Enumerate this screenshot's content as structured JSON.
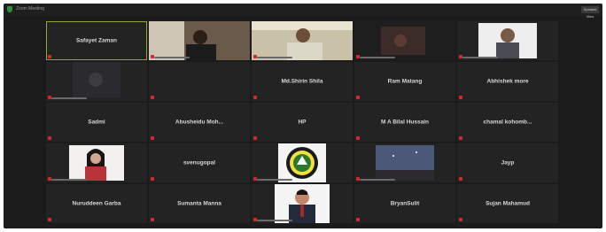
{
  "window": {
    "title": "Zoom Meeting",
    "view_label": "Speaker View"
  },
  "participants": [
    {
      "name": "Safayet Zaman",
      "video": false,
      "active": true
    },
    {
      "name": "",
      "video": true,
      "kind": "person-dark"
    },
    {
      "name": "",
      "video": true,
      "kind": "person-room"
    },
    {
      "name": "",
      "video": true,
      "kind": "person-dim"
    },
    {
      "name": "",
      "video": true,
      "kind": "person-photo"
    },
    {
      "name": "",
      "video": true,
      "kind": "dim-room"
    },
    {
      "name": "",
      "video": false
    },
    {
      "name": "Md.Shirin Shila",
      "video": false
    },
    {
      "name": "Ram Matang",
      "video": false
    },
    {
      "name": "Abhishek more",
      "video": false
    },
    {
      "name": "Sadmi",
      "video": false
    },
    {
      "name": "Abusheidu  Moh...",
      "video": false
    },
    {
      "name": "HP",
      "video": false
    },
    {
      "name": "M A Bilal Hussain",
      "video": false
    },
    {
      "name": "chamal  kohomb...",
      "video": false
    },
    {
      "name": "",
      "video": true,
      "kind": "woman"
    },
    {
      "name": "svenugopal",
      "video": false
    },
    {
      "name": "",
      "video": true,
      "kind": "logo"
    },
    {
      "name": "",
      "video": true,
      "kind": "sky"
    },
    {
      "name": "Jayp",
      "video": false
    },
    {
      "name": "Nuruddeen Garba",
      "video": false
    },
    {
      "name": "Sumanta Manna",
      "video": false
    },
    {
      "name": "",
      "video": true,
      "kind": "man-suit"
    },
    {
      "name": "BryanSulit",
      "video": false
    },
    {
      "name": "Sujan Mahamud",
      "video": false
    }
  ]
}
